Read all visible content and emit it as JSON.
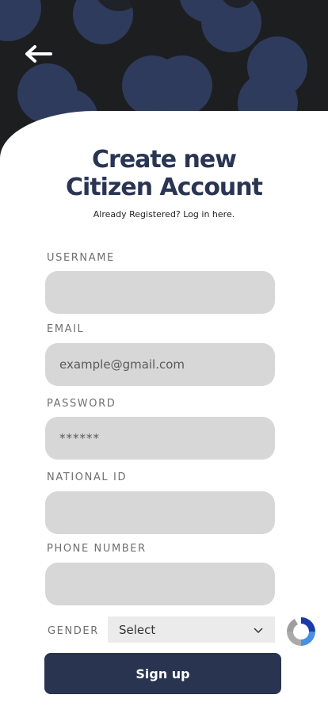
{
  "title_line1": "Create new",
  "title_line2": "Citizen Account",
  "login_link": "Already Registered? Log in here.",
  "fields": {
    "username": {
      "label": "USERNAME",
      "placeholder": ""
    },
    "email": {
      "label": "EMAIL",
      "placeholder": "example@gmail.com"
    },
    "password": {
      "label": "PASSWORD",
      "placeholder": "******"
    },
    "national_id": {
      "label": "NATIONAL ID",
      "placeholder": ""
    },
    "phone": {
      "label": "PHONE NUMBER",
      "placeholder": ""
    }
  },
  "gender": {
    "label": "GENDER",
    "selected": "Select"
  },
  "signup_label": "Sign up",
  "icons": {
    "back": "arrow-left-icon",
    "dropdown": "chevron-down-icon",
    "captcha": "recaptcha-icon"
  },
  "colors": {
    "primary": "#283450",
    "hero_bg": "#1c1e20",
    "circles": "#2e3b5c",
    "field_bg": "#d7d7d7"
  }
}
